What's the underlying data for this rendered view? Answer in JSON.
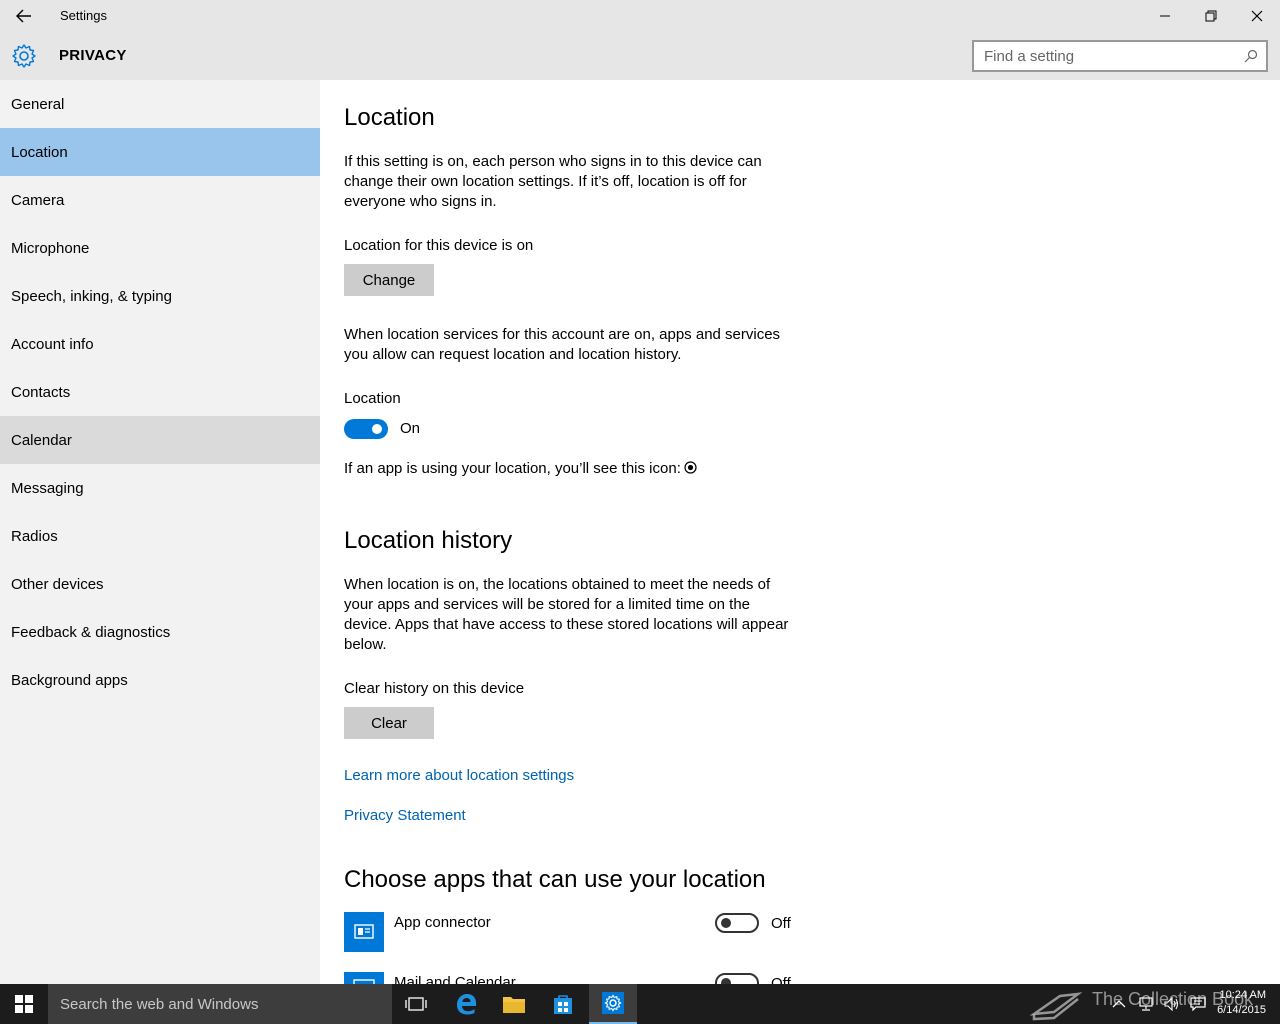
{
  "window": {
    "title": "Settings",
    "section_title": "PRIVACY"
  },
  "search": {
    "placeholder": "Find a setting"
  },
  "sidebar": {
    "items": [
      {
        "label": "General"
      },
      {
        "label": "Location"
      },
      {
        "label": "Camera"
      },
      {
        "label": "Microphone"
      },
      {
        "label": "Speech, inking, & typing"
      },
      {
        "label": "Account info"
      },
      {
        "label": "Contacts"
      },
      {
        "label": "Calendar"
      },
      {
        "label": "Messaging"
      },
      {
        "label": "Radios"
      },
      {
        "label": "Other devices"
      },
      {
        "label": "Feedback & diagnostics"
      },
      {
        "label": "Background apps"
      }
    ],
    "selected": "Location",
    "hovered": "Calendar"
  },
  "location": {
    "heading": "Location",
    "description": "If this setting is on, each person who signs in to this device can change their own location settings. If it’s off, location is off for everyone who signs in.",
    "device_status": "Location for this device is on",
    "change_button": "Change",
    "account_description": "When location services for this account are on, apps and services you allow can request location and location history.",
    "toggle_label": "Location",
    "toggle_state": "On",
    "icon_note": "If an app is using your location, you’ll see this icon:"
  },
  "history": {
    "heading": "Location history",
    "description": "When location is on, the locations obtained to meet the needs of your apps and services will be stored for a limited time on the device. Apps that have access to these stored locations will appear below.",
    "clear_label": "Clear history on this device",
    "clear_button": "Clear",
    "learn_more_link": "Learn more about location settings",
    "privacy_link": "Privacy Statement"
  },
  "apps": {
    "heading": "Choose apps that can use your location",
    "items": [
      {
        "name": "App connector",
        "state": "Off"
      },
      {
        "name": "Mail and Calendar",
        "state": "Off"
      }
    ]
  },
  "taskbar": {
    "search_text": "Search the web and Windows",
    "time": "10:24 AM",
    "date": "6/14/2015",
    "watermark": "The Collection Book"
  },
  "colors": {
    "accent": "#0078d7",
    "selected_nav": "#99c4eb",
    "link": "#0063b1"
  }
}
